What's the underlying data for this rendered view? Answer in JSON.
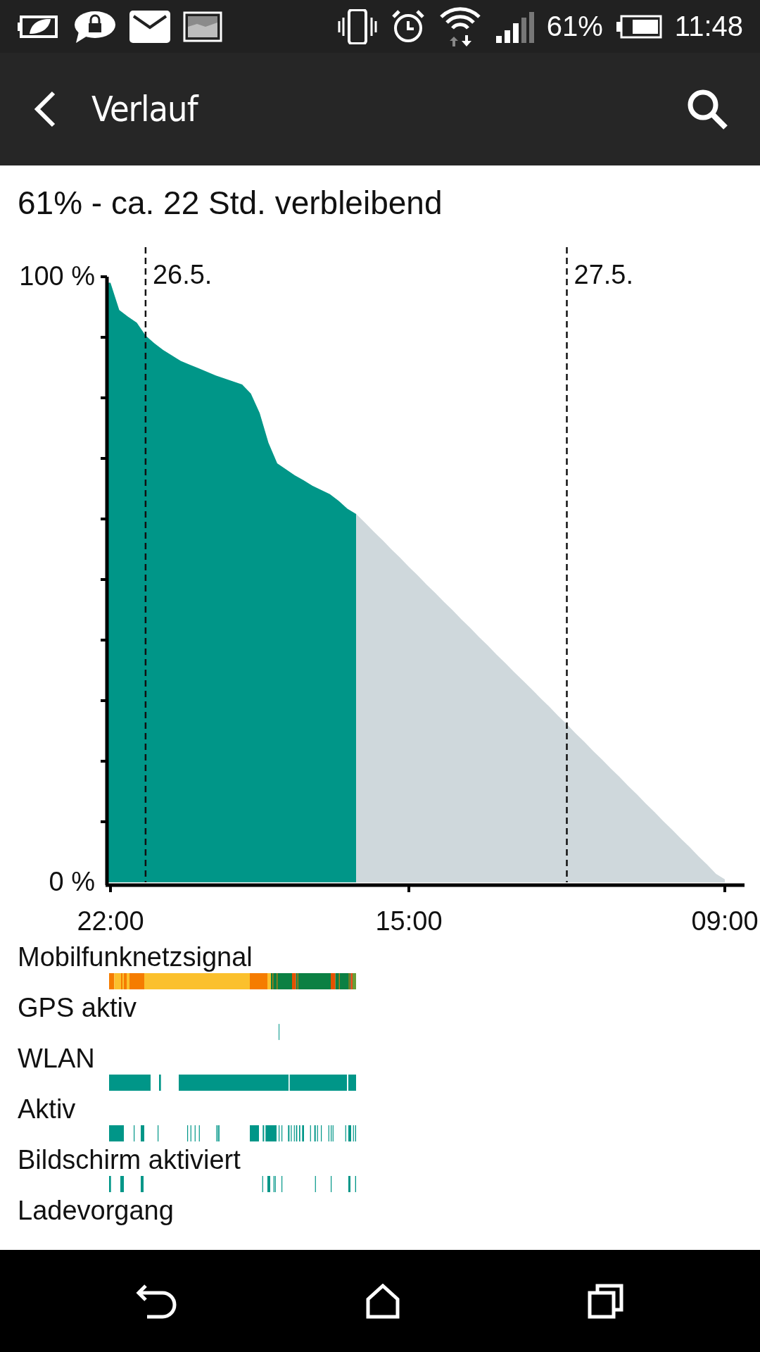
{
  "status_bar": {
    "battery": "61%",
    "time": "11:48"
  },
  "app_bar": {
    "title": "Verlauf"
  },
  "summary": "61% - ca. 22 Std. verbleibend",
  "chart": {
    "chart_data": {
      "type": "area",
      "categories": [
        "22:00",
        null,
        null,
        null,
        null,
        null,
        null,
        null,
        null,
        null,
        null,
        null,
        null,
        null,
        null,
        null,
        null,
        null,
        null,
        null,
        null,
        null,
        null,
        null,
        null,
        null,
        null,
        null,
        null,
        null,
        null,
        null,
        null,
        null,
        "15:00",
        null,
        null,
        null,
        null,
        null,
        null,
        null,
        null,
        null,
        null,
        null,
        null,
        null,
        null,
        null,
        null,
        null,
        null,
        null,
        null,
        null,
        null,
        null,
        null,
        null,
        null,
        null,
        null,
        null,
        null,
        null,
        null,
        null,
        null,
        null,
        "09:00"
      ],
      "series": [
        {
          "color": "#009688",
          "values": [
            99,
            94.5,
            93.4,
            92.4,
            90.3,
            89,
            87.9,
            87,
            86.1,
            85.5,
            84.9,
            84.3,
            83.7,
            83.2,
            82.7,
            82.2,
            80.7,
            77.5,
            72.6,
            69.2,
            68.2,
            67.2,
            66.4,
            65.5,
            64.8,
            64.1,
            63,
            61.7,
            60.8,
            null,
            null,
            null,
            null,
            null,
            null,
            null,
            null,
            null,
            null,
            null,
            null,
            null,
            null,
            null,
            null,
            null,
            null,
            null,
            null,
            null,
            null,
            null,
            null,
            null,
            null,
            null,
            null,
            null,
            null,
            null,
            null,
            null,
            null,
            null,
            null,
            null,
            null,
            null,
            null,
            null,
            null
          ]
        },
        {
          "color": "#cfd8dc",
          "values": [
            null,
            null,
            null,
            null,
            null,
            null,
            null,
            null,
            null,
            null,
            null,
            null,
            null,
            null,
            null,
            null,
            null,
            null,
            null,
            null,
            null,
            null,
            null,
            null,
            null,
            null,
            null,
            null,
            60.8,
            59.4,
            57.9,
            56.5,
            55,
            53.6,
            52.1,
            50.7,
            49.2,
            47.8,
            46.3,
            44.9,
            43.4,
            42,
            40.5,
            39.1,
            37.6,
            36.2,
            34.7,
            33.3,
            31.9,
            30.4,
            29,
            27.5,
            26.1,
            24.6,
            23.2,
            21.7,
            20.3,
            18.8,
            17.4,
            15.9,
            14.5,
            13,
            11.6,
            10.1,
            8.7,
            7.2,
            5.8,
            4.3,
            2.9,
            1.4,
            0.5
          ]
        }
      ],
      "ylim": [
        0,
        100
      ],
      "yticks": [
        {
          "value": 0,
          "label": "0 %"
        },
        {
          "value": 100,
          "label": "100 %"
        }
      ],
      "annotations": [
        "26.5.",
        "27.5."
      ]
    }
  },
  "tracks": [
    {
      "label": "Mobilfunknetzsignal",
      "kind": "signal"
    },
    {
      "label": "GPS aktiv",
      "kind": "events"
    },
    {
      "label": "WLAN",
      "kind": "events"
    },
    {
      "label": "Aktiv",
      "kind": "events"
    },
    {
      "label": "Bildschirm aktiviert",
      "kind": "events"
    },
    {
      "label": "Ladevorgang",
      "kind": "none"
    }
  ]
}
